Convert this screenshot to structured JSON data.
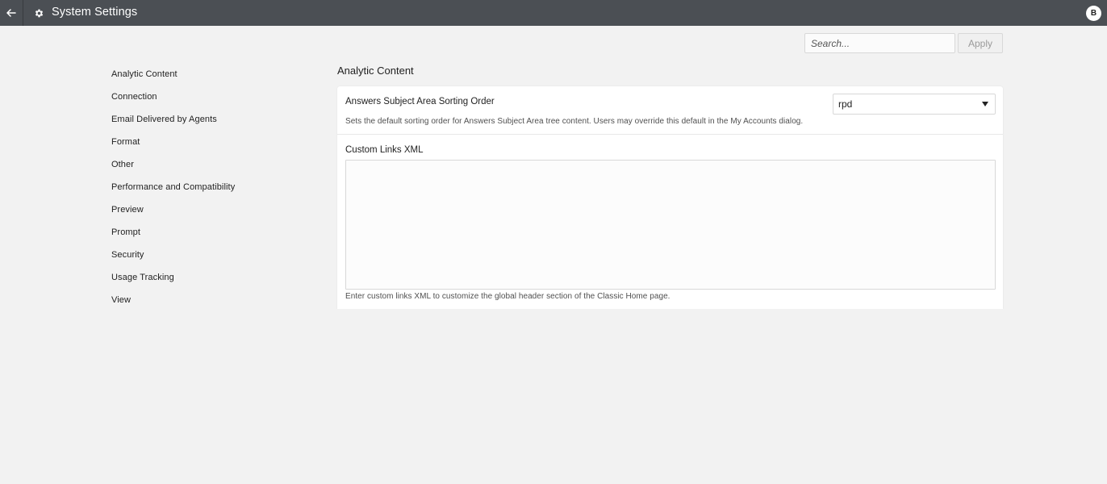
{
  "header": {
    "back_icon": "arrow-left-icon",
    "settings_icon": "gear-icon",
    "title": "System Settings",
    "avatar_initial": "B"
  },
  "toolbar": {
    "search_placeholder": "Search...",
    "search_value": "",
    "apply_label": "Apply"
  },
  "sidebar": {
    "items": [
      {
        "label": "Analytic Content"
      },
      {
        "label": "Connection"
      },
      {
        "label": "Email Delivered by Agents"
      },
      {
        "label": "Format"
      },
      {
        "label": "Other"
      },
      {
        "label": "Performance and Compatibility"
      },
      {
        "label": "Preview"
      },
      {
        "label": "Prompt"
      },
      {
        "label": "Security"
      },
      {
        "label": "Usage Tracking"
      },
      {
        "label": "View"
      }
    ]
  },
  "main": {
    "section_title": "Analytic Content",
    "settings": [
      {
        "label": "Answers Subject Area Sorting Order",
        "value": "rpd",
        "description": "Sets the default sorting order for Answers Subject Area tree content. Users may override this default in the My Accounts dialog."
      },
      {
        "label": "Custom Links XML",
        "value": "",
        "description": "Enter custom links XML to customize the global header section of the Classic Home page."
      }
    ]
  },
  "colors": {
    "header_bg": "#4b4f54",
    "page_bg": "#f2f2f2",
    "panel_bg": "#ffffff"
  }
}
